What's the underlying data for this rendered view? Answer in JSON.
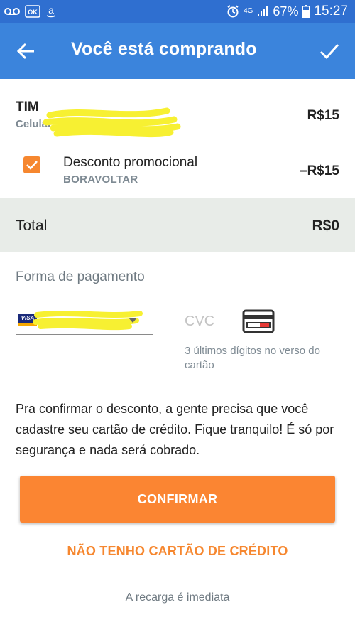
{
  "status_bar": {
    "left_icons": [
      "voicemail-icon",
      "ok-icon",
      "amazon-icon"
    ],
    "network": "4G",
    "battery": "67%",
    "time": "15:27"
  },
  "app_bar": {
    "title": "Você está comprando"
  },
  "order": {
    "operator": "TIM",
    "number_prefix": "Celular",
    "price": "R$15",
    "discount": {
      "checked": true,
      "title": "Desconto promocional",
      "code": "BORAVOLTAR",
      "price": "–R$15"
    }
  },
  "total": {
    "label": "Total",
    "value": "R$0"
  },
  "payment": {
    "title": "Forma de pagamento",
    "card_brand": "VISA",
    "cvc_placeholder": "CVC",
    "cvc_help": "3 últimos dígitos no verso do cartão"
  },
  "info_text": "Pra confirmar o desconto, a gente precisa que você cadastre seu cartão de crédito. Fique tranquilo! É só por segurança e nada será cobrado.",
  "buttons": {
    "confirm": "CONFIRMAR",
    "no_card": "NÃO TENHO CARTÃO DE CRÉDITO"
  },
  "footer_note": "A recarga é imediata",
  "colors": {
    "status_bar": "#2f6fd0",
    "app_bar": "#3b84dc",
    "accent": "#fb8532",
    "total_bg": "#e8ece8"
  }
}
